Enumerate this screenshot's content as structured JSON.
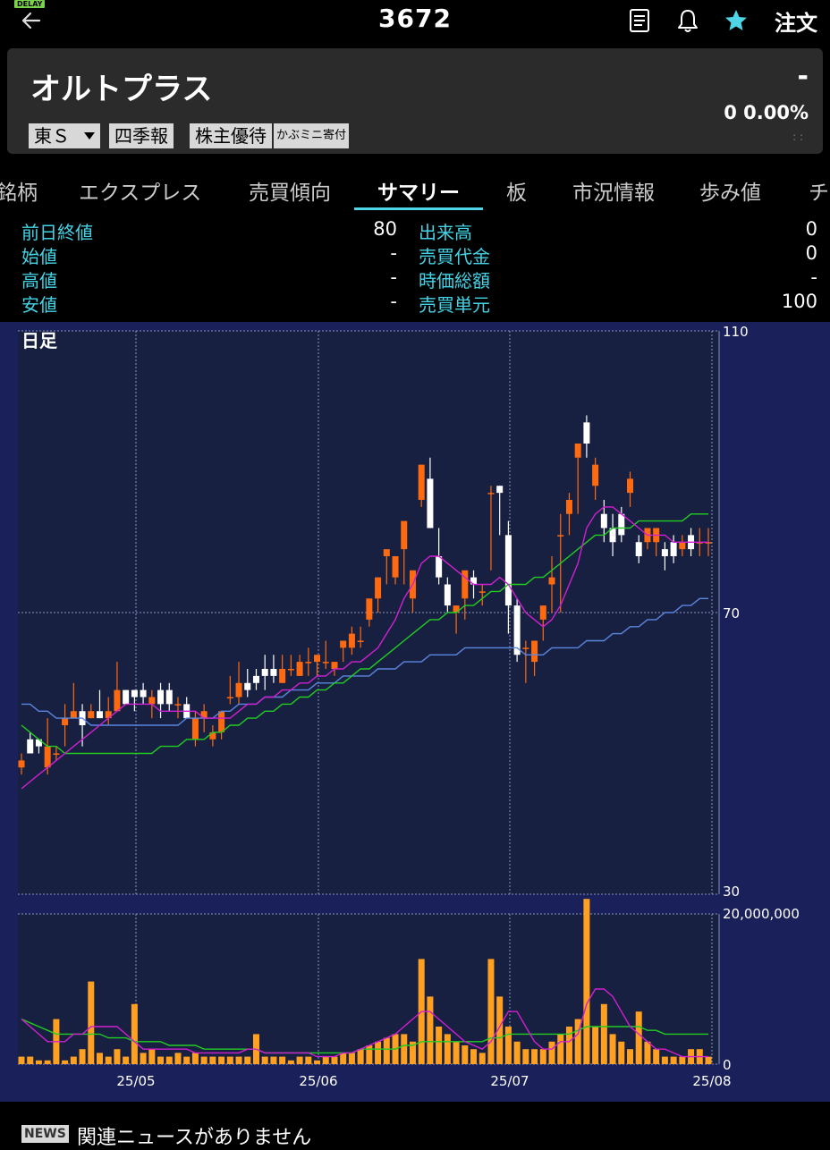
{
  "header": {
    "delay_badge": "DELAY",
    "code": "3672",
    "order_label": "注文",
    "icons": [
      "back-arrow-icon",
      "memo-icon",
      "bell-icon",
      "star-icon"
    ],
    "star_color": "#4fd6e6"
  },
  "stock": {
    "name": "オルトプラス",
    "price": "-",
    "change": "0  0.00%",
    "dots": ": :",
    "market": "東Ｓ",
    "tags": [
      "四季報",
      "株主優待",
      "かぶミニ寄付"
    ]
  },
  "tabs": [
    {
      "label": "銘柄"
    },
    {
      "label": "エクスプレス"
    },
    {
      "label": "売買傾向"
    },
    {
      "label": "サマリー",
      "active": true
    },
    {
      "label": "板"
    },
    {
      "label": "市況情報"
    },
    {
      "label": "歩み値"
    },
    {
      "label": "チ"
    }
  ],
  "summary": {
    "left": [
      {
        "label": "前日終値",
        "value": "80"
      },
      {
        "label": "始値",
        "value": "-"
      },
      {
        "label": "高値",
        "value": "-"
      },
      {
        "label": "安値",
        "value": "-"
      }
    ],
    "right": [
      {
        "label": "出来高",
        "value": "0"
      },
      {
        "label": "売買代金",
        "value": "0"
      },
      {
        "label": "時価総額",
        "value": "-"
      },
      {
        "label": "売買単元",
        "value": "100"
      }
    ]
  },
  "chart_data": {
    "type": "candlestick",
    "title": "日足",
    "price_axis": {
      "ticks": [
        110,
        70,
        30
      ],
      "range": [
        30,
        110
      ]
    },
    "volume_axis": {
      "ticks": [
        "20,000,000",
        "0"
      ],
      "range": [
        0,
        20000000
      ]
    },
    "x_labels": [
      "25/05",
      "25/06",
      "25/07",
      "25/08"
    ],
    "colors": {
      "up": "#ff6a10",
      "down": "#ffffff",
      "ma_short": "#d020d0",
      "ma_mid": "#22cc22",
      "ma_long": "#5b86e0",
      "volume": "#ffa020",
      "grid": "#8a93c0",
      "bg": "#172040"
    },
    "candles": [
      [
        48,
        50,
        47,
        49
      ],
      [
        52,
        53,
        50,
        50
      ],
      [
        52,
        52,
        50,
        51
      ],
      [
        48,
        55,
        47,
        51
      ],
      [
        50,
        51,
        49,
        50
      ],
      [
        54,
        57,
        51,
        55
      ],
      [
        55,
        60,
        55,
        56
      ],
      [
        56,
        57,
        51,
        54
      ],
      [
        55,
        57,
        55,
        56
      ],
      [
        56,
        59,
        56,
        55
      ],
      [
        55,
        58,
        54,
        56
      ],
      [
        56,
        63,
        56,
        59
      ],
      [
        59,
        59,
        57,
        57
      ],
      [
        59,
        59,
        56,
        58
      ],
      [
        59,
        60,
        57,
        58
      ],
      [
        57,
        59,
        55,
        58
      ],
      [
        59,
        60,
        55,
        57
      ],
      [
        59,
        60,
        56,
        57
      ],
      [
        57,
        58,
        55,
        57
      ],
      [
        57,
        58,
        55,
        55
      ],
      [
        52,
        56,
        51,
        55
      ],
      [
        55,
        57,
        53,
        56
      ],
      [
        52,
        54,
        51,
        53
      ],
      [
        53,
        56,
        52,
        56
      ],
      [
        58,
        61,
        57,
        58
      ],
      [
        58,
        63,
        57,
        60
      ],
      [
        60,
        62,
        58,
        59
      ],
      [
        61,
        62,
        59,
        60
      ],
      [
        62,
        64,
        59,
        61
      ],
      [
        62,
        64,
        60,
        61
      ],
      [
        60,
        64,
        60,
        62
      ],
      [
        62,
        64,
        61,
        62
      ],
      [
        61,
        64,
        61,
        63
      ],
      [
        63,
        65,
        61,
        63
      ],
      [
        63,
        64,
        61,
        64
      ],
      [
        63,
        66,
        62,
        63
      ],
      [
        62,
        63,
        61,
        63
      ],
      [
        65,
        66,
        63,
        66
      ],
      [
        65,
        68,
        64,
        67
      ],
      [
        66,
        68,
        65,
        66
      ],
      [
        69,
        71,
        68,
        72
      ],
      [
        72,
        75,
        70,
        75
      ],
      [
        78,
        78,
        74,
        79
      ],
      [
        75,
        76,
        74,
        78
      ],
      [
        79,
        81,
        74,
        83
      ],
      [
        72,
        75,
        70,
        76
      ],
      [
        86,
        90,
        85,
        91
      ],
      [
        89,
        92,
        85,
        82
      ],
      [
        78,
        82,
        74,
        75
      ],
      [
        74,
        75,
        70,
        71
      ],
      [
        70,
        70,
        67,
        71
      ],
      [
        72,
        73,
        69,
        76
      ],
      [
        75,
        76,
        72,
        74
      ],
      [
        73,
        74,
        71,
        73
      ],
      [
        87,
        88,
        76,
        87
      ],
      [
        88,
        88,
        81,
        87
      ],
      [
        81,
        83,
        67,
        71
      ],
      [
        71,
        72,
        63,
        64
      ],
      [
        65,
        66,
        60,
        65
      ],
      [
        63,
        66,
        61,
        66
      ],
      [
        69,
        70,
        66,
        71
      ],
      [
        74,
        78,
        70,
        75
      ],
      [
        81,
        84,
        70,
        81
      ],
      [
        84,
        87,
        81,
        86
      ],
      [
        92,
        92,
        84,
        94
      ],
      [
        97,
        98,
        92,
        94
      ],
      [
        88,
        92,
        86,
        91
      ],
      [
        84,
        86,
        80,
        82
      ],
      [
        82,
        84,
        78,
        80
      ],
      [
        84,
        85,
        80,
        81
      ],
      [
        87,
        90,
        85,
        89
      ],
      [
        80,
        81,
        77,
        78
      ],
      [
        80,
        82,
        79,
        82
      ],
      [
        80,
        82,
        78,
        82
      ],
      [
        79,
        80,
        76,
        78
      ],
      [
        80,
        81,
        77,
        78
      ],
      [
        79,
        81,
        78,
        80
      ],
      [
        81,
        82,
        78,
        79
      ],
      [
        80,
        82,
        78,
        80
      ],
      [
        80,
        82,
        78,
        80
      ]
    ],
    "ma_short": [
      45,
      46,
      47,
      48,
      49,
      50,
      51,
      52,
      53,
      54,
      55,
      56,
      57,
      57,
      57,
      57,
      56,
      56,
      56,
      56,
      56,
      55,
      55,
      55,
      55,
      56,
      57,
      57,
      58,
      58,
      59,
      59,
      60,
      60,
      61,
      61,
      62,
      62,
      63,
      63,
      64,
      65,
      67,
      69,
      72,
      74,
      77,
      78,
      78,
      77,
      76,
      75,
      74,
      74,
      74,
      75,
      74,
      72,
      70,
      69,
      68,
      69,
      71,
      74,
      77,
      82,
      84,
      85,
      85,
      84,
      83,
      82,
      81,
      81,
      81,
      80,
      80,
      80,
      80,
      80
    ],
    "ma_mid": [
      54,
      53,
      52,
      51,
      51,
      50,
      50,
      50,
      50,
      50,
      50,
      50,
      50,
      50,
      50,
      50,
      51,
      51,
      51,
      52,
      52,
      52,
      53,
      53,
      54,
      54,
      55,
      55,
      56,
      56,
      57,
      57,
      58,
      58,
      59,
      59,
      60,
      60,
      61,
      62,
      62,
      63,
      64,
      65,
      66,
      67,
      68,
      69,
      69,
      70,
      70,
      71,
      71,
      72,
      73,
      73,
      74,
      74,
      74,
      75,
      75,
      76,
      77,
      78,
      79,
      80,
      81,
      81,
      82,
      82,
      82,
      83,
      83,
      83,
      83,
      83,
      83,
      84,
      84,
      84
    ],
    "ma_long": [
      57,
      57,
      56,
      56,
      55,
      55,
      55,
      55,
      54,
      54,
      54,
      54,
      54,
      54,
      54,
      54,
      54,
      54,
      54,
      55,
      55,
      55,
      55,
      56,
      56,
      57,
      57,
      57,
      58,
      58,
      58,
      59,
      59,
      59,
      60,
      60,
      60,
      61,
      61,
      61,
      61,
      62,
      62,
      62,
      63,
      63,
      63,
      64,
      64,
      64,
      64,
      65,
      65,
      65,
      65,
      65,
      65,
      65,
      64,
      64,
      64,
      65,
      65,
      65,
      65,
      66,
      66,
      66,
      67,
      67,
      68,
      68,
      69,
      69,
      70,
      70,
      71,
      71,
      72,
      72
    ],
    "volume": [
      1,
      1,
      0.5,
      0.5,
      6,
      0.5,
      1,
      2,
      11,
      1.5,
      1,
      2,
      1,
      8,
      1.5,
      2,
      1,
      1,
      1.5,
      1,
      1.5,
      1,
      1,
      1,
      1,
      1,
      1,
      4,
      1,
      1,
      1,
      0.5,
      1,
      1,
      0.5,
      1,
      1,
      1.5,
      1.5,
      2,
      2.5,
      3,
      3.5,
      4,
      4,
      3,
      14,
      9,
      5,
      4,
      3,
      2.5,
      2,
      1.5,
      14,
      9,
      5,
      3,
      2,
      2,
      2,
      3,
      4,
      5,
      6,
      22,
      5,
      8,
      4,
      3,
      2,
      7,
      3,
      2,
      1,
      1,
      1,
      2,
      2,
      1
    ],
    "vol_ma_short": [
      6,
      5,
      4,
      3,
      3,
      3,
      4,
      4,
      5,
      5,
      5,
      5,
      4,
      3,
      2,
      2,
      2,
      2,
      2,
      2,
      1.5,
      1.5,
      1.5,
      1.5,
      1.5,
      1.5,
      2,
      2,
      1.5,
      1.5,
      1.5,
      1.5,
      1.5,
      1.5,
      1,
      1,
      1,
      1.5,
      1.5,
      2,
      2.5,
      3,
      3.5,
      4,
      5,
      6,
      7,
      7,
      6,
      5,
      4,
      3,
      2.5,
      2,
      3,
      5,
      7,
      7,
      5,
      3,
      2,
      2,
      3,
      3,
      4,
      8,
      10,
      10,
      9,
      7,
      5,
      4,
      3,
      2,
      2,
      1.5,
      1,
      1,
      1,
      1
    ],
    "vol_ma_long": [
      6,
      5.5,
      5,
      4.5,
      4,
      4,
      4,
      4,
      4,
      4,
      3.5,
      3.5,
      3.5,
      3,
      3,
      3,
      3,
      2.5,
      2.5,
      2.5,
      2.5,
      2,
      2,
      2,
      2,
      2,
      2,
      2,
      1.5,
      1.5,
      1.5,
      1.5,
      1.5,
      1.5,
      1.5,
      1.5,
      1.5,
      1.5,
      1.5,
      2,
      2,
      2,
      2,
      2,
      2.5,
      2.5,
      3,
      3,
      3,
      3,
      3,
      3,
      3,
      3,
      3.5,
      3.5,
      4,
      4,
      4,
      4,
      4,
      4,
      4,
      4,
      4.5,
      5,
      5,
      5,
      5,
      5,
      5,
      5,
      4.5,
      4.5,
      4,
      4,
      4,
      4,
      4,
      4
    ]
  },
  "news": {
    "badge": "NEWS",
    "text": "関連ニュースがありません"
  }
}
